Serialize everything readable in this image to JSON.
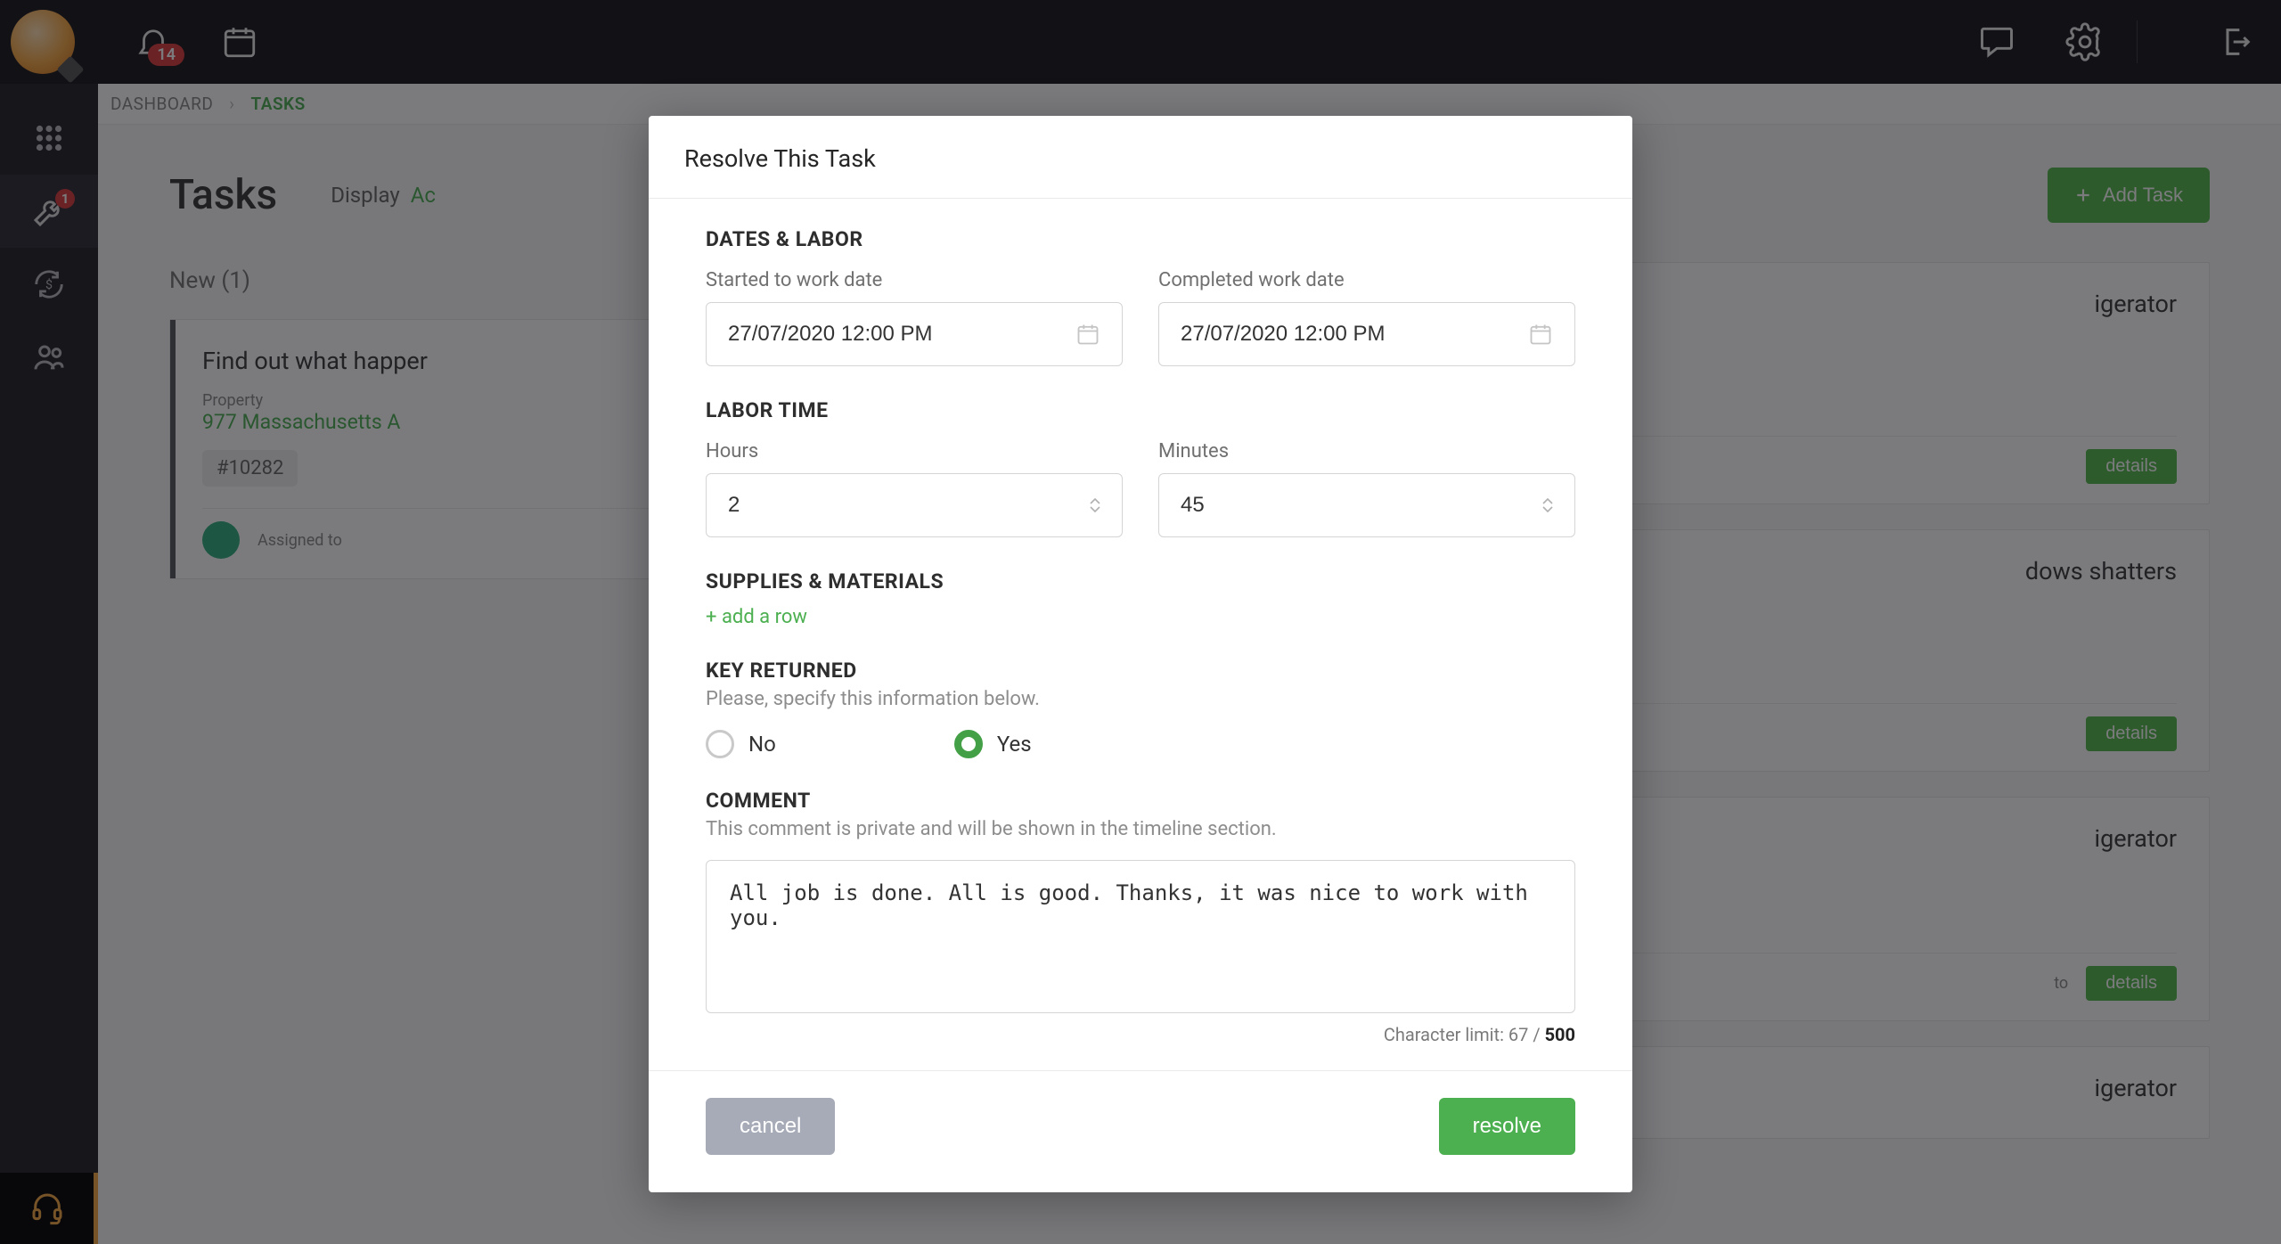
{
  "topbar": {
    "notification_count": "14"
  },
  "sidenav": {
    "tasks_badge": "1"
  },
  "breadcrumb": {
    "root": "DASHBOARD",
    "current": "TASKS"
  },
  "page": {
    "title": "Tasks",
    "display_label": "Display",
    "display_value_prefix": "Ac",
    "add_task_label": "Add Task"
  },
  "columns": {
    "new_header": "New (1)"
  },
  "new_task": {
    "title_prefix": "Find out what happer",
    "property_label": "Property",
    "property_value": "977 Massachusetts A",
    "id": "#10282",
    "assigned_label": "Assigned to"
  },
  "right_tasks": {
    "t1": {
      "title_suffix": "igerator",
      "details": "details"
    },
    "t2": {
      "title_suffix": "dows shatters",
      "details": "details"
    },
    "t3": {
      "title_suffix": "igerator",
      "details": "details",
      "assigned_suffix": "to"
    },
    "t4": {
      "title_suffix": "igerator"
    }
  },
  "modal": {
    "title": "Resolve This Task",
    "sections": {
      "dates_labor": "DATES & LABOR",
      "labor_time": "LABOR TIME",
      "supplies": "SUPPLIES & MATERIALS",
      "key_returned": "KEY RETURNED",
      "key_returned_sub": "Please, specify this information below.",
      "comment": "COMMENT",
      "comment_sub": "This comment is private and will be shown in the timeline section."
    },
    "fields": {
      "started_label": "Started to work date",
      "started_value": "27/07/2020 12:00 PM",
      "completed_label": "Completed work date",
      "completed_value": "27/07/2020 12:00 PM",
      "hours_label": "Hours",
      "hours_value": "2",
      "minutes_label": "Minutes",
      "minutes_value": "45"
    },
    "add_row": "+ add a row",
    "radio_no": "No",
    "radio_yes": "Yes",
    "comment_value": "All job is done. All is good. Thanks, it was nice to work with you.",
    "char_prefix": "Character limit: ",
    "char_count": "67",
    "char_sep": " / ",
    "char_max": "500",
    "cancel": "cancel",
    "resolve": "resolve"
  }
}
